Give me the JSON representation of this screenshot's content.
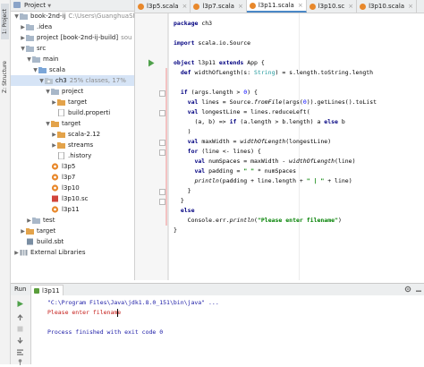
{
  "left_strip": {
    "project_tab": "1: Project",
    "structure_tab": "Z: Structure"
  },
  "project_panel": {
    "header": {
      "view_mode": "Project"
    },
    "tree": [
      {
        "label": "book-2nd-ij",
        "muted": "C:\\Users\\GuanghuaShi\\",
        "indent": 0,
        "arrow": "▼",
        "icon": "folder-icon"
      },
      {
        "label": ".idea",
        "muted": "",
        "indent": 1,
        "arrow": "▶",
        "icon": "folder-icon"
      },
      {
        "label": "project [book-2nd-ij-build]",
        "muted": "sou",
        "indent": 1,
        "arrow": "▶",
        "icon": "folder-icon"
      },
      {
        "label": "src",
        "muted": "",
        "indent": 1,
        "arrow": "▼",
        "icon": "folder-icon"
      },
      {
        "label": "main",
        "muted": "",
        "indent": 2,
        "arrow": "▼",
        "icon": "folder-icon"
      },
      {
        "label": "scala",
        "muted": "",
        "indent": 3,
        "arrow": "▼",
        "icon": "source-folder-icon"
      },
      {
        "label": "ch3",
        "muted": "25% classes, 17%",
        "indent": 4,
        "arrow": "▼",
        "icon": "package-icon",
        "selected": true
      },
      {
        "label": "project",
        "muted": "",
        "indent": 5,
        "arrow": "▼",
        "icon": "folder-icon"
      },
      {
        "label": "target",
        "muted": "",
        "indent": 6,
        "arrow": "▶",
        "icon": "target-folder-icon"
      },
      {
        "label": "build.properti",
        "muted": "",
        "indent": 6,
        "arrow": "",
        "icon": "file-icon"
      },
      {
        "label": "target",
        "muted": "",
        "indent": 5,
        "arrow": "▼",
        "icon": "target-folder-icon"
      },
      {
        "label": "scala-2.12",
        "muted": "",
        "indent": 6,
        "arrow": "▶",
        "icon": "target-folder-icon"
      },
      {
        "label": "streams",
        "muted": "",
        "indent": 6,
        "arrow": "▶",
        "icon": "target-folder-icon"
      },
      {
        "label": ".history",
        "muted": "",
        "indent": 6,
        "arrow": "",
        "icon": "file-icon"
      },
      {
        "label": "l3p5",
        "muted": "",
        "indent": 5,
        "arrow": "",
        "icon": "scala-object-icon"
      },
      {
        "label": "l3p7",
        "muted": "",
        "indent": 5,
        "arrow": "",
        "icon": "scala-object-icon"
      },
      {
        "label": "l3p10",
        "muted": "",
        "indent": 5,
        "arrow": "",
        "icon": "scala-object-icon"
      },
      {
        "label": "l3p10.sc",
        "muted": "",
        "indent": 5,
        "arrow": "",
        "icon": "scala-worksheet-icon"
      },
      {
        "label": "l3p11",
        "muted": "",
        "indent": 5,
        "arrow": "",
        "icon": "scala-object-icon"
      },
      {
        "label": "test",
        "muted": "",
        "indent": 2,
        "arrow": "▶",
        "icon": "folder-icon"
      },
      {
        "label": "target",
        "muted": "",
        "indent": 1,
        "arrow": "▶",
        "icon": "target-folder-icon"
      },
      {
        "label": "build.sbt",
        "muted": "",
        "indent": 1,
        "arrow": "",
        "icon": "sbt-file-icon"
      },
      {
        "label": "External Libraries",
        "muted": "",
        "indent": 0,
        "arrow": "▶",
        "icon": "library-icon"
      }
    ]
  },
  "editor_tabs": [
    {
      "label": "l3p5.scala",
      "active": false
    },
    {
      "label": "l3p7.scala",
      "active": false
    },
    {
      "label": "l3p11.scala",
      "active": true
    },
    {
      "label": "l3p10.sc",
      "active": false
    },
    {
      "label": "l3p10.scala",
      "active": false
    }
  ],
  "code_lines": [
    "package ch3",
    "",
    "import scala.io.Source",
    "",
    "object l3p11 extends App {",
    "  def widthOfLength(s: String) = s.length.toString.length",
    "",
    "  if (args.length > 0) {",
    "    val lines = Source.fromFile(args(0)).getLines().toList",
    "    val longestLine = lines.reduceLeft(",
    "      (a, b) => if (a.length > b.length) a else b",
    "    )",
    "    val maxWidth = widthOfLength(longestLine)",
    "    for (line <- lines) {",
    "      val numSpaces = maxWidth - widthOfLength(line)",
    "      val padding = \" \" * numSpaces",
    "      println(padding + line.length + \" | \" + line)",
    "    }",
    "  }",
    "  else",
    "    Console.err.println(\"Please enter filename\")",
    "}",
    ""
  ],
  "run_panel": {
    "title": "Run",
    "config_name": "l3p11",
    "console_lines": [
      {
        "text": "\"C:\\Program Files\\Java\\jdk1.8.0_151\\bin\\java\" ...",
        "color": "#1a1aa6"
      },
      {
        "text": "Please enter filename",
        "color": "#c41a16"
      },
      {
        "text": "",
        "color": "#000000"
      },
      {
        "text": "Process finished with exit code 0",
        "color": "#1a1aa6"
      }
    ]
  },
  "colors": {
    "accent": "#4a88c7",
    "error_text": "#c41a16",
    "process_text": "#1a1aa6"
  }
}
